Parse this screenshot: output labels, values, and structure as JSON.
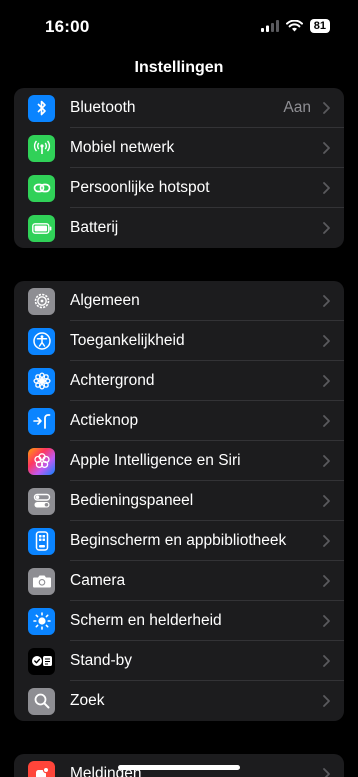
{
  "status": {
    "time": "16:00",
    "battery": "81"
  },
  "nav": {
    "title": "Instellingen"
  },
  "group1": [
    {
      "label": "Bluetooth",
      "value": "Aan",
      "icon": "bluetooth-icon",
      "color": "#0a84ff"
    },
    {
      "label": "Mobiel netwerk",
      "icon": "antenna-icon",
      "color": "#30d158"
    },
    {
      "label": "Persoonlijke hotspot",
      "icon": "hotspot-link-icon",
      "color": "#30d158"
    },
    {
      "label": "Batterij",
      "icon": "battery-icon",
      "color": "#30d158"
    }
  ],
  "group2": [
    {
      "label": "Algemeen",
      "icon": "gear-icon",
      "color": "#8e8e93"
    },
    {
      "label": "Toegankelijkheid",
      "icon": "accessibility-icon",
      "color": "#0a84ff"
    },
    {
      "label": "Achtergrond",
      "icon": "flower-icon",
      "color": "#0a84ff"
    },
    {
      "label": "Actieknop",
      "icon": "action-button-icon",
      "color": "#0a84ff"
    },
    {
      "label": "Apple Intelligence en Siri",
      "icon": "apple-intelligence-icon",
      "color": "#b45cf0"
    },
    {
      "label": "Bedieningspaneel",
      "icon": "control-center-icon",
      "color": "#8e8e93"
    },
    {
      "label": "Beginscherm en appbibliotheek",
      "icon": "home-screen-icon",
      "color": "#0a84ff"
    },
    {
      "label": "Camera",
      "icon": "camera-icon",
      "color": "#8e8e93"
    },
    {
      "label": "Scherm en helderheid",
      "icon": "sun-icon",
      "color": "#0a84ff"
    },
    {
      "label": "Stand-by",
      "icon": "standby-icon",
      "color": "#000000"
    },
    {
      "label": "Zoek",
      "icon": "search-icon",
      "color": "#8e8e93"
    }
  ],
  "group3": [
    {
      "label": "Meldingen",
      "icon": "notifications-icon",
      "color": "#ff453a"
    }
  ]
}
